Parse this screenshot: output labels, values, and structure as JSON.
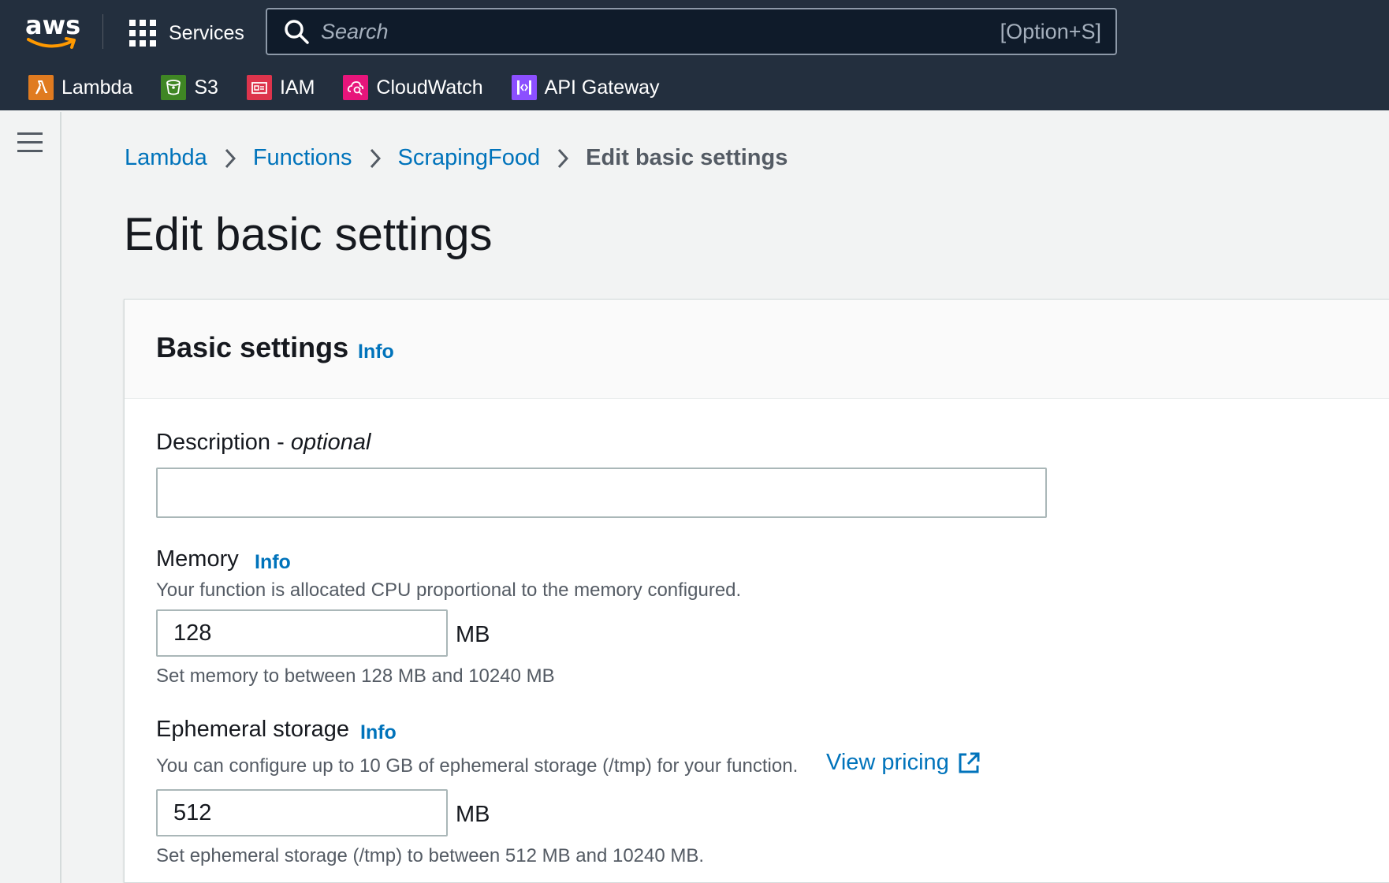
{
  "nav": {
    "logo_text": "aws",
    "services_label": "Services",
    "search_placeholder": "Search",
    "search_shortcut": "[Option+S]",
    "favorites": [
      {
        "label": "Lambda",
        "icon": "lambda-icon",
        "color": "#e07b20"
      },
      {
        "label": "S3",
        "icon": "s3-bucket-icon",
        "color": "#3f8624"
      },
      {
        "label": "IAM",
        "icon": "iam-icon",
        "color": "#dd344c"
      },
      {
        "label": "CloudWatch",
        "icon": "cloudwatch-icon",
        "color": "#e7157b"
      },
      {
        "label": "API Gateway",
        "icon": "api-gateway-icon",
        "color": "#8c4fff"
      }
    ]
  },
  "breadcrumb": {
    "items": [
      "Lambda",
      "Functions",
      "ScrapingFood"
    ],
    "current": "Edit basic settings"
  },
  "page": {
    "title": "Edit basic settings"
  },
  "card": {
    "title": "Basic settings",
    "info": "Info",
    "description": {
      "label": "Description - ",
      "label_optional": "optional",
      "value": "",
      "placeholder": ""
    },
    "memory": {
      "label": "Memory",
      "info": "Info",
      "help": "Your function is allocated CPU proportional to the memory configured.",
      "value": "128",
      "unit": "MB",
      "constraint": "Set memory to between 128 MB and 10240 MB"
    },
    "ephemeral": {
      "label": "Ephemeral storage",
      "info": "Info",
      "help": "You can configure up to 10 GB of ephemeral storage (/tmp) for your function.",
      "link": "View pricing",
      "value": "512",
      "unit": "MB",
      "constraint": "Set ephemeral storage (/tmp) to between 512 MB and 10240 MB."
    }
  },
  "colors": {
    "nav_bg": "#232f3e",
    "link": "#0073bb",
    "page_bg": "#f2f3f3"
  }
}
